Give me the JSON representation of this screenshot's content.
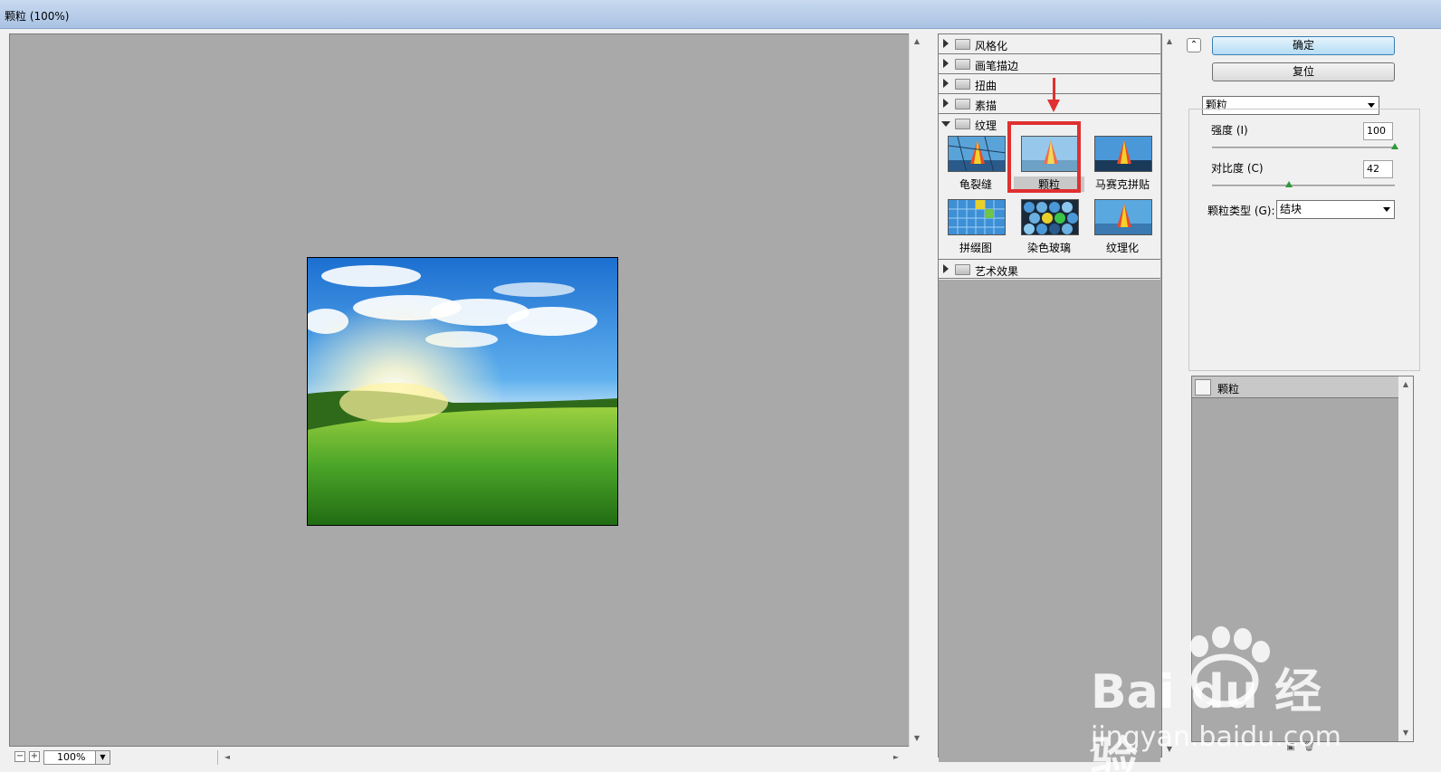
{
  "window": {
    "title": "颗粒 (100%)"
  },
  "preview": {
    "zoom_level": "100%"
  },
  "gallery": {
    "categories": [
      {
        "label": "风格化",
        "expanded": false
      },
      {
        "label": "画笔描边",
        "expanded": false
      },
      {
        "label": "扭曲",
        "expanded": false
      },
      {
        "label": "素描",
        "expanded": false
      },
      {
        "label": "纹理",
        "expanded": true
      },
      {
        "label": "艺术效果",
        "expanded": false
      }
    ],
    "texture_filters": [
      {
        "label": "龟裂缝",
        "selected": false
      },
      {
        "label": "颗粒",
        "selected": true
      },
      {
        "label": "马赛克拼贴",
        "selected": false
      },
      {
        "label": "拼缀图",
        "selected": false
      },
      {
        "label": "染色玻璃",
        "selected": false
      },
      {
        "label": "纹理化",
        "selected": false
      }
    ]
  },
  "buttons": {
    "ok": "确定",
    "reset": "复位"
  },
  "settings": {
    "filter_select": "颗粒",
    "intensity_label": "强度 (I)",
    "intensity_value": "100",
    "intensity_fraction": 1.0,
    "contrast_label": "对比度 (C)",
    "contrast_value": "42",
    "contrast_fraction": 0.42,
    "grain_type_label": "颗粒类型 (G):",
    "grain_type_value": "结块"
  },
  "effect_layers": [
    {
      "label": "颗粒"
    }
  ],
  "watermark": {
    "text": "Bai du 经验",
    "url": "jingyan.baidu.com"
  },
  "colors": {
    "highlight": "#e03030",
    "preview_bg": "#a9a9a9",
    "ok_button": "#b6dcf5"
  }
}
